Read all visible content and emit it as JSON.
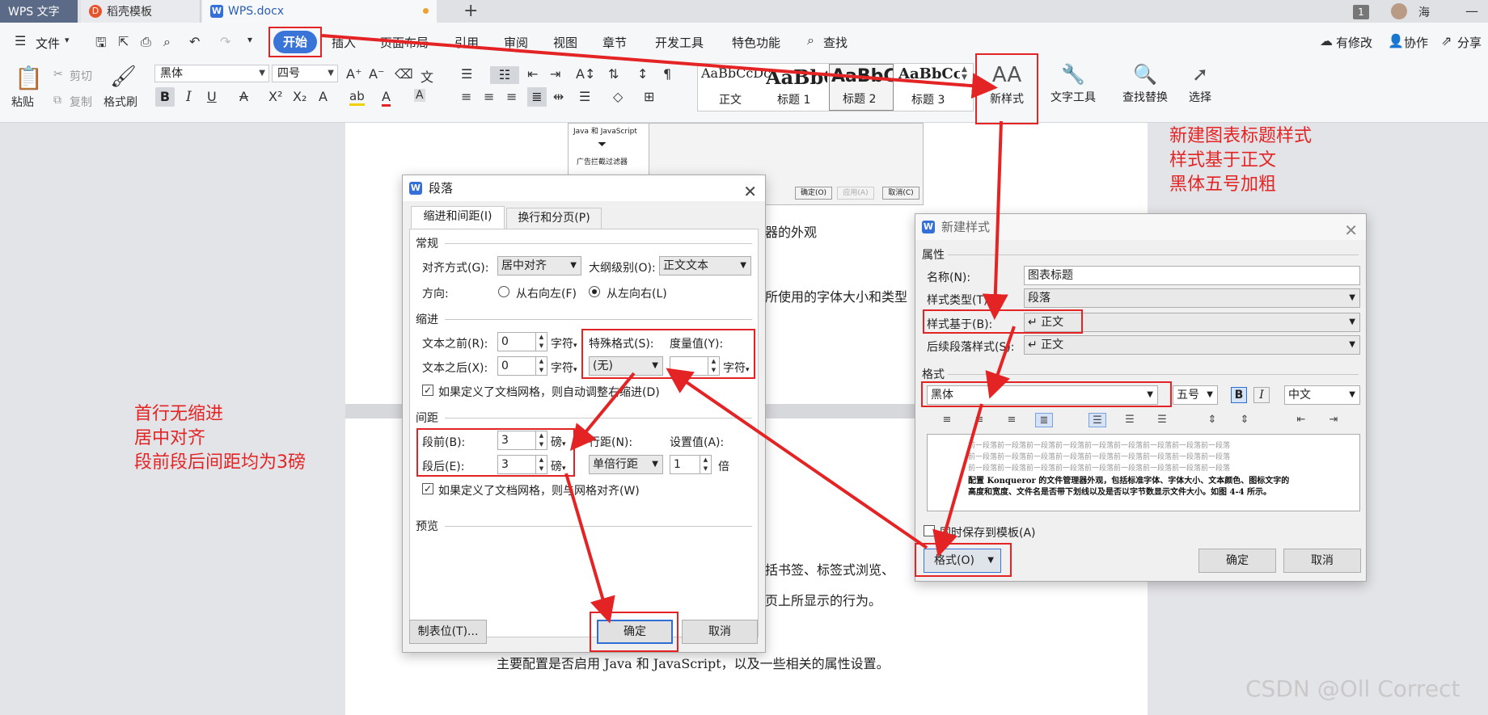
{
  "tabs": {
    "app": "WPS 文字",
    "t1": "稻壳模板",
    "t2": "WPS.docx",
    "add": "+",
    "badge": "1",
    "user": "海"
  },
  "menu": {
    "file": "文件",
    "start": "开始",
    "items": [
      "插入",
      "页面布局",
      "引用",
      "审阅",
      "视图",
      "章节",
      "开发工具",
      "特色功能",
      "查找"
    ],
    "right": [
      "有修改",
      "协作",
      "分享"
    ]
  },
  "ribbon": {
    "paste": "粘贴",
    "cut": "剪切",
    "copy": "复制",
    "format_painter": "格式刷",
    "font": "黑体",
    "size": "四号",
    "styles": [
      {
        "sample": "AaBbCcDc",
        "label": "正文"
      },
      {
        "sample": "AaBbC",
        "label": "标题 1"
      },
      {
        "sample": "AaBbC",
        "label": "标题 2"
      },
      {
        "sample": "AaBbCcl",
        "label": "标题 3"
      }
    ],
    "new_style": "新样式",
    "text_tools": "文字工具",
    "find_replace": "查找替换",
    "select": "选择"
  },
  "doc": {
    "line1": "器的外观",
    "line2": "所使用的字体大小和类型",
    "line3": "括书签、标签式浏览、",
    "line4": "页上所显示的行为。",
    "line5": "主要配置是否启用 Java 和 JavaScript，以及一些相关的属性设置。",
    "embed_text1": "Java 和 JavaScript",
    "embed_text2": "广告拦截过滤器",
    "embed_btns": [
      "确定(O)",
      "应用(A)",
      "取消(C)"
    ]
  },
  "para": {
    "title": "段落",
    "tab1": "缩进和间距(I)",
    "tab2": "换行和分页(P)",
    "general": "常规",
    "align_label": "对齐方式(G):",
    "align_value": "居中对齐",
    "outline_label": "大纲级别(O):",
    "outline_value": "正文文本",
    "dir_label": "方向:",
    "rtl": "从右向左(F)",
    "ltr": "从左向右(L)",
    "indent": "缩进",
    "before_label": "文本之前(R):",
    "before_value": "0",
    "after_label": "文本之后(X):",
    "after_value": "0",
    "unit_char": "字符",
    "special_label": "特殊格式(S):",
    "special_value": "(无)",
    "measure_label": "度量值(Y):",
    "grid_indent": "如果定义了文档网格，则自动调整右缩进(D)",
    "spacing": "间距",
    "sb_label": "段前(B):",
    "sb_value": "3",
    "sa_label": "段后(E):",
    "sa_value": "3",
    "unit_pt": "磅",
    "ls_label": "行距(N):",
    "ls_value": "单倍行距",
    "set_label": "设置值(A):",
    "set_value": "1",
    "unit_times": "倍",
    "grid_align": "如果定义了文档网格，则与网格对齐(W)",
    "preview": "预览",
    "tabs_btn": "制表位(T)...",
    "ok": "确定",
    "cancel": "取消"
  },
  "newstyle": {
    "title": "新建样式",
    "props": "属性",
    "name_label": "名称(N):",
    "name_value": "图表标题",
    "type_label": "样式类型(T):",
    "type_value": "段落",
    "based_label": "样式基于(B):",
    "based_value": "↵ 正文",
    "next_label": "后续段落样式(S):",
    "next_value": "↵ 正文",
    "format": "格式",
    "font": "黑体",
    "size": "五号",
    "bold": "B",
    "italic": "I",
    "lang": "中文",
    "preview_prev": "前一段落前一段落前一段落前一段落前一段落前一段落前一段落前一段落前一段落",
    "preview_text1": "配置 Konqueror 的文件管理器外观，包括标准字体、字体大小、文本颜色、图标文字的",
    "preview_text2": "高度和宽度、文件名是否带下划线以及是否以字节数显示文件大小。如图 4-4 所示。",
    "save_tpl": "同时保存到模板(A)",
    "format_btn": "格式(O)",
    "ok": "确定",
    "cancel": "取消"
  },
  "annotations": {
    "right": [
      "新建图表标题样式",
      "样式基于正文",
      "黑体五号加粗"
    ],
    "left": [
      "首行无缩进",
      "居中对齐",
      "段前段后间距均为3磅"
    ]
  },
  "watermark": "CSDN @Oll Correct",
  "colors": {
    "accent": "#3a74d9",
    "annotation": "#e42424"
  }
}
